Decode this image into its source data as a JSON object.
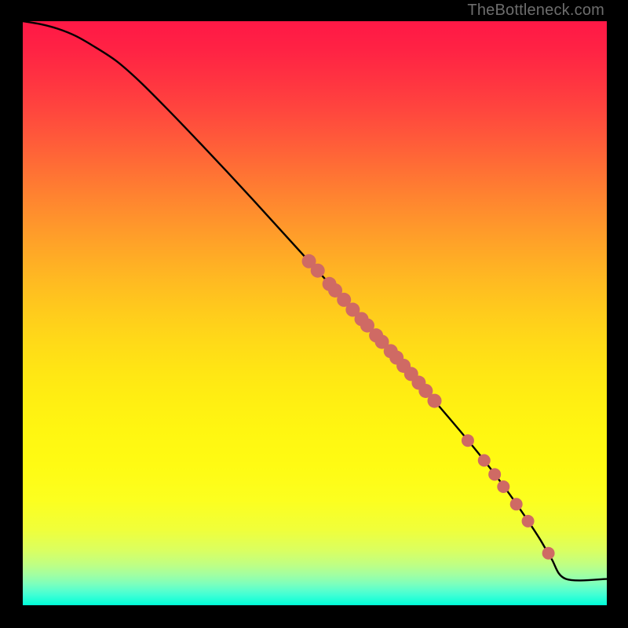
{
  "watermark": "TheBottleneck.com",
  "chart_data": {
    "type": "line",
    "title": "",
    "xlabel": "",
    "ylabel": "",
    "xlim": [
      0,
      100
    ],
    "ylim": [
      0,
      100
    ],
    "grid": false,
    "legend_position": "none",
    "gradient_stops": [
      {
        "pos": 0.0,
        "color": "#ff1846"
      },
      {
        "pos": 0.05,
        "color": "#ff2344"
      },
      {
        "pos": 0.1,
        "color": "#ff3341"
      },
      {
        "pos": 0.15,
        "color": "#ff453e"
      },
      {
        "pos": 0.2,
        "color": "#ff593a"
      },
      {
        "pos": 0.25,
        "color": "#ff6e35"
      },
      {
        "pos": 0.3,
        "color": "#ff8330"
      },
      {
        "pos": 0.35,
        "color": "#ff972b"
      },
      {
        "pos": 0.4,
        "color": "#ffaa26"
      },
      {
        "pos": 0.45,
        "color": "#ffbc21"
      },
      {
        "pos": 0.5,
        "color": "#ffcc1c"
      },
      {
        "pos": 0.55,
        "color": "#ffda18"
      },
      {
        "pos": 0.6,
        "color": "#ffe614"
      },
      {
        "pos": 0.65,
        "color": "#ffef12"
      },
      {
        "pos": 0.7,
        "color": "#fff611"
      },
      {
        "pos": 0.76,
        "color": "#fffb13"
      },
      {
        "pos": 0.82,
        "color": "#fcff1f"
      },
      {
        "pos": 0.87,
        "color": "#f0ff3a"
      },
      {
        "pos": 0.905,
        "color": "#dbff5f"
      },
      {
        "pos": 0.93,
        "color": "#c0ff83"
      },
      {
        "pos": 0.948,
        "color": "#a1ffa2"
      },
      {
        "pos": 0.962,
        "color": "#80ffba"
      },
      {
        "pos": 0.973,
        "color": "#5fffcb"
      },
      {
        "pos": 0.983,
        "color": "#3effd5"
      },
      {
        "pos": 1.0,
        "color": "#00ffd8"
      }
    ],
    "series": [
      {
        "name": "curve",
        "type": "line",
        "color": "#000000",
        "x": [
          0,
          3,
          6,
          9,
          12,
          16,
          20,
          25,
          30,
          35,
          40,
          45,
          50,
          55,
          60,
          63,
          67,
          71,
          75,
          79,
          83,
          86,
          88.5,
          90.5,
          93,
          100
        ],
        "y": [
          100,
          99.5,
          98.7,
          97.5,
          95.8,
          93.2,
          89.7,
          84.7,
          79.5,
          74.2,
          68.8,
          63.3,
          57.8,
          52.3,
          46.8,
          43.4,
          39.0,
          34.4,
          29.7,
          24.8,
          19.5,
          15.2,
          11.4,
          8.0,
          4.5,
          4.5
        ]
      },
      {
        "name": "dense-band",
        "type": "scatter",
        "color": "#cf6a64",
        "radius": 9,
        "x": [
          49.0,
          50.5,
          52.5,
          53.5,
          55.0,
          56.5,
          58.0,
          59.0,
          60.5,
          61.5,
          63.0,
          64.0,
          65.2,
          66.5,
          67.8,
          69.0,
          70.5
        ],
        "y": [
          58.9,
          57.3,
          55.0,
          53.9,
          52.3,
          50.6,
          49.0,
          47.9,
          46.2,
          45.1,
          43.5,
          42.4,
          41.0,
          39.6,
          38.1,
          36.7,
          35.0
        ]
      },
      {
        "name": "sparse-points",
        "type": "scatter",
        "color": "#cf6a64",
        "radius": 8,
        "x": [
          76.2,
          79.0,
          80.8,
          82.3,
          84.5,
          86.5,
          90.0
        ],
        "y": [
          28.2,
          24.8,
          22.4,
          20.3,
          17.3,
          14.4,
          8.9
        ]
      }
    ]
  }
}
